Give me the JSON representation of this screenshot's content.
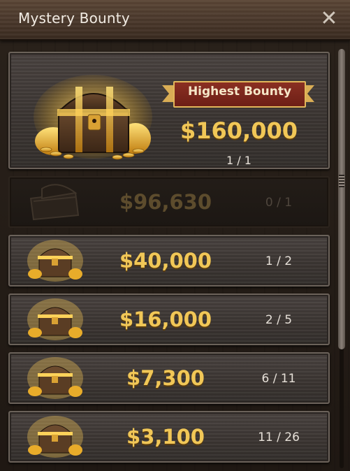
{
  "window": {
    "title": "Mystery Bounty",
    "close_icon": "close-icon"
  },
  "featured": {
    "ribbon_label": "Highest Bounty",
    "amount": "$160,000",
    "count": "1 / 1",
    "icon": "treasure-chest-icon"
  },
  "rows": [
    {
      "amount": "$96,630",
      "count": "0 / 1",
      "state": "claimed",
      "icon": "empty-chest-icon"
    },
    {
      "amount": "$40,000",
      "count": "1 / 2",
      "state": "active",
      "icon": "treasure-chest-icon"
    },
    {
      "amount": "$16,000",
      "count": "2 / 5",
      "state": "active",
      "icon": "treasure-chest-icon"
    },
    {
      "amount": "$7,300",
      "count": "6 / 11",
      "state": "active",
      "icon": "treasure-chest-icon"
    },
    {
      "amount": "$3,100",
      "count": "11 / 26",
      "state": "active",
      "icon": "treasure-chest-icon"
    }
  ],
  "colors": {
    "gold": "#f1c757",
    "ribbon": "#8a2f22",
    "ribbon_border": "#e2b65a"
  }
}
